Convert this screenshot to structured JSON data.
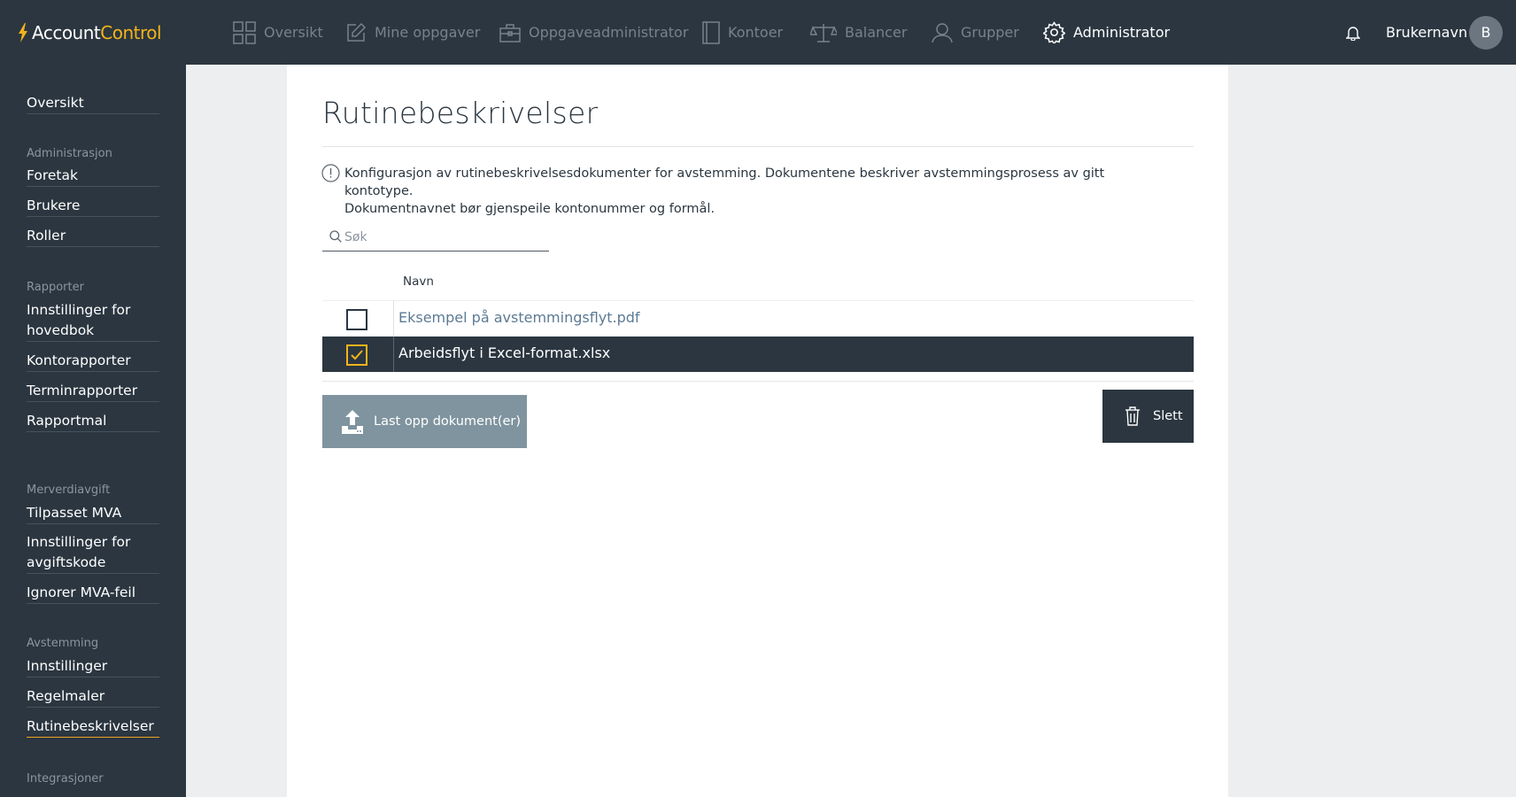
{
  "brand": {
    "part1": "Account",
    "part2": "Control",
    "accent": "#f3b31b"
  },
  "nav": [
    {
      "label": "Oversikt",
      "icon": "grid-icon"
    },
    {
      "label": "Mine oppgaver",
      "icon": "edit-icon"
    },
    {
      "label": "Oppgaveadministrator",
      "icon": "briefcase-icon"
    },
    {
      "label": "Kontoer",
      "icon": "book-icon"
    },
    {
      "label": "Balancer",
      "icon": "scale-icon"
    },
    {
      "label": "Grupper",
      "icon": "user-icon"
    },
    {
      "label": "Administrator",
      "icon": "gear-icon",
      "active": true
    }
  ],
  "user": {
    "name": "Brukernavn",
    "initial": "B"
  },
  "sidebar": {
    "top": "Oversikt",
    "sections": [
      {
        "heading": "Administrasjon",
        "items": [
          "Foretak",
          "Brukere",
          "Roller"
        ]
      },
      {
        "heading": "Rapporter",
        "items": [
          "Innstillinger for hovedbok",
          "Kontorapporter",
          "Terminrapporter",
          "Rapportmal"
        ]
      },
      {
        "heading": "Merverdiavgift",
        "items": [
          "Tilpasset MVA",
          "Innstillinger for avgiftskode",
          "Ignorer MVA-feil"
        ]
      },
      {
        "heading": "Avstemming",
        "items": [
          "Innstillinger",
          "Regelmaler",
          "Rutinebeskrivelser"
        ]
      },
      {
        "heading": "Integrasjoner",
        "items": []
      }
    ],
    "active": "Rutinebeskrivelser"
  },
  "page": {
    "title": "Rutinebeskrivelser",
    "info_line1": "Konfigurasjon av rutinebeskrivelsesdokumenter for avstemming. Dokumentene beskriver avstemmingsprosess av gitt kontotype.",
    "info_line2": "Dokumentnavnet bør gjenspeile kontonummer og formål.",
    "search_placeholder": "Søk",
    "column_name": "Navn",
    "rows": [
      {
        "name": "Eksempel på avstemmingsflyt.pdf",
        "checked": false
      },
      {
        "name": "Arbeidsflyt i Excel-format.xlsx",
        "checked": true
      }
    ],
    "upload_label": "Last opp dokument(er)",
    "delete_label": "Slett"
  }
}
